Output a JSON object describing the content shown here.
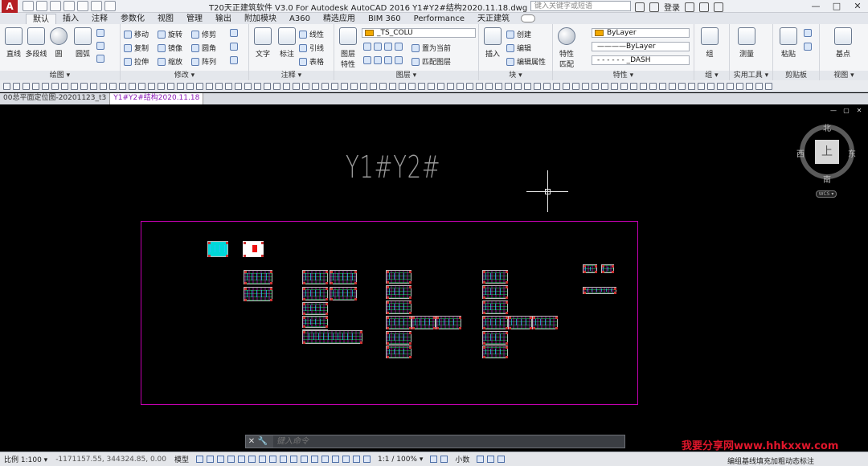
{
  "titlebar": {
    "logo": "A",
    "title": "T20天正建筑软件 V3.0 For Autodesk AutoCAD 2016    Y1#Y2#结构2020.11.18.dwg",
    "search_placeholder": "键入关键字或短语",
    "signin": "登录",
    "window_controls": [
      "—",
      "□",
      "✕"
    ]
  },
  "ribbon_tabs": [
    "默认",
    "插入",
    "注释",
    "参数化",
    "视图",
    "管理",
    "输出",
    "附加模块",
    "A360",
    "精选应用",
    "BIM 360",
    "Performance",
    "天正建筑"
  ],
  "ribbon": {
    "draw": {
      "title": "绘图 ▾",
      "line": "直线",
      "polyline": "多段线",
      "circle": "圆",
      "arc": "圆弧"
    },
    "modify": {
      "title": "修改 ▾",
      "move": "移动",
      "rotate": "旋转",
      "trim": "修剪",
      "copy": "复制",
      "mirror": "镜像",
      "fillet": "圆角",
      "stretch": "拉伸",
      "scale": "缩放",
      "array": "阵列"
    },
    "annotation": {
      "title": "注释 ▾",
      "text": "文字",
      "dimension": "标注",
      "linear": "线性",
      "leader": "引线",
      "table": "表格"
    },
    "layers": {
      "title": "图层 ▾",
      "layer_props": "图层\n特性",
      "current_layer": "_TS_COLU",
      "set_current": "置为当前",
      "match_layer": "匹配图层"
    },
    "block": {
      "title": "块 ▾",
      "insert": "插入",
      "create": "创建",
      "edit": "编辑",
      "edit_attr": "编辑属性"
    },
    "properties": {
      "title": "特性 ▾",
      "match": "特性\n匹配",
      "color": "ByLayer",
      "lineweight": "————ByLayer",
      "linetype": "- - - - - - _DASH"
    },
    "groups": {
      "title": "组 ▾",
      "group": "组"
    },
    "utilities": {
      "title": "实用工具 ▾",
      "measure": "测量"
    },
    "clipboard": {
      "title": "剪贴板",
      "paste": "粘贴"
    },
    "view": {
      "title": "视图 ▾",
      "base": "基点"
    }
  },
  "file_tabs": [
    "00总平面定位图-20201123_t3",
    "Y1#Y2#结构2020.11.18"
  ],
  "viewport_controls": [
    "—",
    "▢",
    "✕"
  ],
  "drawing": {
    "title_text": "Y1#Y2#",
    "viewcube": {
      "top": "上",
      "north": "北",
      "south": "南",
      "east": "东",
      "west": "西",
      "wcs": "WCS ▾"
    }
  },
  "command": {
    "placeholder": "键入命令",
    "close": "✕",
    "settings": "🔧"
  },
  "watermark": "我要分享网www.hhkxxw.com",
  "statusbar": {
    "scale": "比例 1:100 ▾",
    "coords": "-1171157.55, 344324.85, 0.00",
    "model": "模型",
    "zoom": "1:1 / 100% ▾",
    "units": "小数",
    "right_text": "编组基线填充加粗动态标注"
  }
}
